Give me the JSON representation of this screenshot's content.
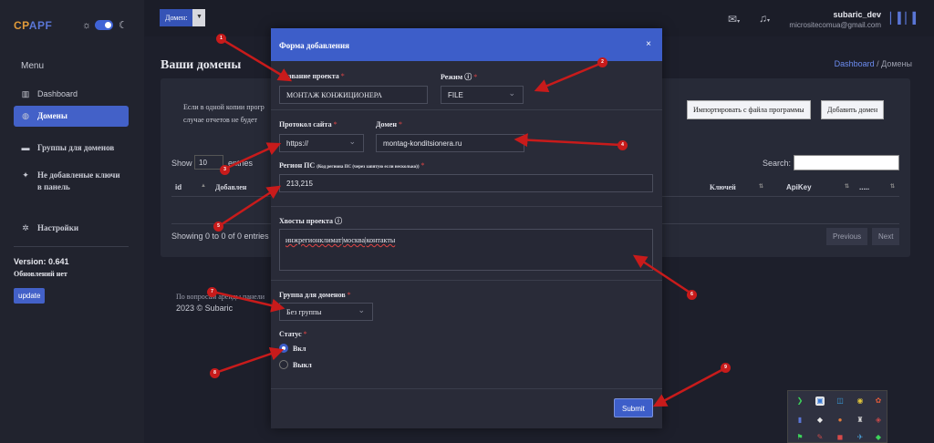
{
  "logo": {
    "c1": "CP",
    "c2": "APF"
  },
  "sidebar": {
    "menu_title": "Menu",
    "items": [
      {
        "label": "Dashboard",
        "icon": "chart-icon"
      },
      {
        "label": "Домены",
        "icon": "globe-icon"
      },
      {
        "label": "Группы для доменов",
        "icon": "folder-icon"
      },
      {
        "label": "Не добавленые ключи в панель",
        "icon": "star-icon"
      },
      {
        "label": "Настройки",
        "icon": "gear-icon"
      }
    ],
    "version": "Version: 0.641",
    "updates": "Обновлений нет",
    "update_btn": "update"
  },
  "topbar": {
    "domain_label": "Домен:",
    "user_name": "subaric_dev",
    "user_email": "micrositecomua@gmail.com"
  },
  "main": {
    "title": "Ваши домены",
    "breadcrumb_link": "Dashboard",
    "breadcrumb_sep": "/",
    "breadcrumb_current": "Домены",
    "info_line1": "Если в одной копии прогр",
    "info_line2": "случае отчетов не будет",
    "import_btn": "Импортировать с файла программы",
    "add_btn": "Добавить домен",
    "show_label": "Show",
    "show_value": "10",
    "entries_label": "entries",
    "search_label": "Search:",
    "columns": [
      "id",
      "Добавлен",
      "Ключей",
      "ApiKey",
      "....."
    ],
    "showing": "Showing 0 to 0 of 0 entries",
    "prev": "Previous",
    "next": "Next",
    "footer1": "По вопросам аренды панели",
    "footer2": "2023 © Subaric"
  },
  "modal": {
    "title": "Форма добавления",
    "close": "×",
    "project_name_label": "Название проекта",
    "project_name_value": "МОНТАЖ КОНЖИЦИОНЕРА",
    "mode_label": "Режим",
    "mode_value": "FILE",
    "protocol_label": "Протокол сайта",
    "protocol_value": "https://",
    "domain_label": "Домен",
    "domain_value": "montag-konditsionera.ru",
    "region_label": "Регион ПС",
    "region_hint": "(Код региона ПС (через запятую если несколько))",
    "region_value": "213,215",
    "tails_label": "Хвосты проекта",
    "tails_parts": [
      "инжрегионклимат",
      "москва",
      "контакты"
    ],
    "group_label": "Группа для доменов",
    "group_value": "Без группы",
    "status_label": "Статус",
    "status_on": "Вкл",
    "status_off": "Выкл",
    "submit": "Submit"
  },
  "annotations": [
    "1",
    "2",
    "3",
    "4",
    "5",
    "6",
    "7",
    "8",
    "9"
  ],
  "colors": {
    "accent": "#3d5ec9",
    "annotation": "#c81b1b"
  }
}
